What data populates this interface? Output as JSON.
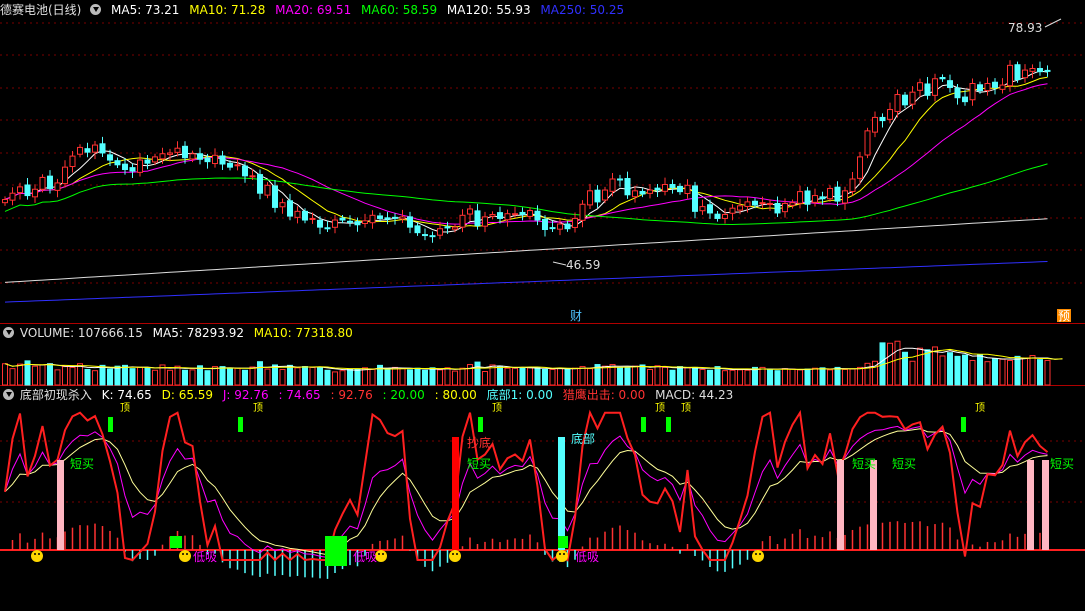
{
  "price_header": {
    "title": "德赛电池(日线)",
    "ma5": "MA5: 73.21",
    "ma10": "MA10: 71.28",
    "ma20": "MA20: 69.51",
    "ma60": "MA60: 58.59",
    "ma120": "MA120: 55.93",
    "ma250": "MA250: 50.25"
  },
  "volume_header": {
    "title": "VOLUME: 107666.15",
    "ma5": "MA5: 78293.92",
    "ma10": "MA10: 77318.80"
  },
  "indicator_header": {
    "title": "底部初现杀入",
    "k": "K: 74.65",
    "d": "D: 65.59",
    "j": "J: 92.76",
    "v1": ": 74.65",
    "v2": ": 92.76",
    "v3": ": 20.00",
    "v4": ": 80.00",
    "bottom1": "底部1: 0.00",
    "eagle": "猎鹰出击: 0.00",
    "macd": "MACD: 44.23"
  },
  "price_annotations": {
    "high_label": "78.93",
    "low_label": "46.59",
    "marker_cai": "财",
    "marker_yu": "预"
  },
  "indicator_labels": {
    "short_buy": "短买",
    "low_suck": "低吸",
    "bottom": "底部",
    "chaodi": "抄底",
    "top": "顶"
  },
  "colors": {
    "ma5": "#ffffff",
    "ma10": "#ffff00",
    "ma20": "#ff00ff",
    "ma60": "#00ff00",
    "ma120": "#ffffff",
    "ma250": "#3030ff",
    "up": "#ff3232",
    "down": "#54ffff"
  },
  "chart_data": {
    "type": "candlestick",
    "title": "德赛电池(日线)",
    "ylim": [
      44,
      81
    ],
    "high": 78.93,
    "low": 46.59,
    "ma_last": {
      "MA5": 73.21,
      "MA10": 71.28,
      "MA20": 69.51,
      "MA60": 58.59,
      "MA120": 55.93,
      "MA250": 50.25
    },
    "close": [
      58.0,
      58.8,
      59.6,
      58.5,
      59.3,
      60.8,
      59.4,
      60.1,
      62.1,
      63.5,
      64.6,
      64.0,
      64.9,
      63.9,
      63.0,
      62.4,
      61.8,
      61.6,
      63.0,
      62.6,
      63.4,
      63.8,
      63.9,
      64.5,
      63.3,
      63.8,
      63.1,
      62.8,
      63.6,
      62.5,
      62.1,
      62.4,
      61.0,
      61.0,
      58.8,
      59.8,
      57.0,
      57.6,
      55.9,
      56.5,
      55.4,
      55.6,
      54.5,
      54.4,
      55.4,
      55.4,
      55.2,
      54.8,
      55.3,
      56.0,
      55.6,
      55.5,
      55.7,
      55.8,
      54.5,
      53.8,
      53.5,
      53.4,
      54.3,
      54.4,
      54.5,
      56.0,
      56.8,
      54.7,
      55.8,
      56.1,
      55.6,
      56.2,
      56.2,
      56.1,
      56.6,
      55.4,
      54.2,
      54.4,
      54.9,
      54.3,
      55.6,
      57.4,
      59.1,
      57.7,
      59.2,
      60.6,
      60.5,
      58.6,
      59.1,
      58.7,
      59.2,
      59.2,
      59.9,
      59.5,
      59.0,
      59.8,
      56.5,
      57.1,
      56.3,
      55.6,
      56.1,
      56.9,
      57.2,
      57.7,
      57.3,
      57.6,
      57.5,
      56.3,
      57.5,
      57.6,
      59.0,
      57.4,
      58.5,
      58.1,
      59.4,
      57.8,
      59.1,
      60.6,
      63.4,
      66.7,
      68.4,
      68.0,
      69.4,
      71.3,
      70.0,
      71.6,
      72.8,
      71.2,
      73.3,
      73.3,
      72.2,
      70.9,
      70.4,
      72.7,
      71.8,
      72.7,
      72.2,
      72.5,
      75.0,
      73.2,
      74.4,
      74.6,
      74.2,
      74.3
    ],
    "volume": [
      52,
      40,
      51,
      59,
      46,
      49,
      52,
      37,
      45,
      43,
      52,
      38,
      35,
      48,
      39,
      46,
      48,
      40,
      43,
      42,
      36,
      49,
      36,
      46,
      36,
      37,
      47,
      35,
      45,
      45,
      40,
      41,
      36,
      44,
      57,
      39,
      49,
      38,
      48,
      42,
      45,
      43,
      43,
      36,
      32,
      35,
      39,
      39,
      42,
      38,
      48,
      39,
      43,
      40,
      37,
      41,
      36,
      42,
      37,
      42,
      34,
      41,
      50,
      56,
      33,
      49,
      46,
      41,
      41,
      41,
      42,
      42,
      38,
      38,
      41,
      40,
      41,
      45,
      40,
      50,
      46,
      50,
      42,
      43,
      46,
      49,
      38,
      47,
      43,
      36,
      45,
      42,
      43,
      38,
      36,
      45,
      35,
      36,
      37,
      36,
      43,
      43,
      37,
      35,
      40,
      39,
      37,
      39,
      41,
      42,
      37,
      43,
      38,
      39,
      43,
      53,
      58,
      103,
      102,
      107,
      80,
      58,
      90,
      86,
      93,
      71,
      79,
      70,
      73,
      60,
      74,
      57,
      64,
      63,
      60,
      70,
      66,
      72,
      62,
      60,
      54,
      71
    ],
    "volume_ma_last": {
      "MA5": 78293.92,
      "MA10": 77318.8
    },
    "volume_last": 107666.15,
    "indicator": {
      "K": 74.65,
      "D": 65.59,
      "J": 92.76,
      "levels": [
        20,
        80
      ],
      "MACD": 44.23
    }
  }
}
